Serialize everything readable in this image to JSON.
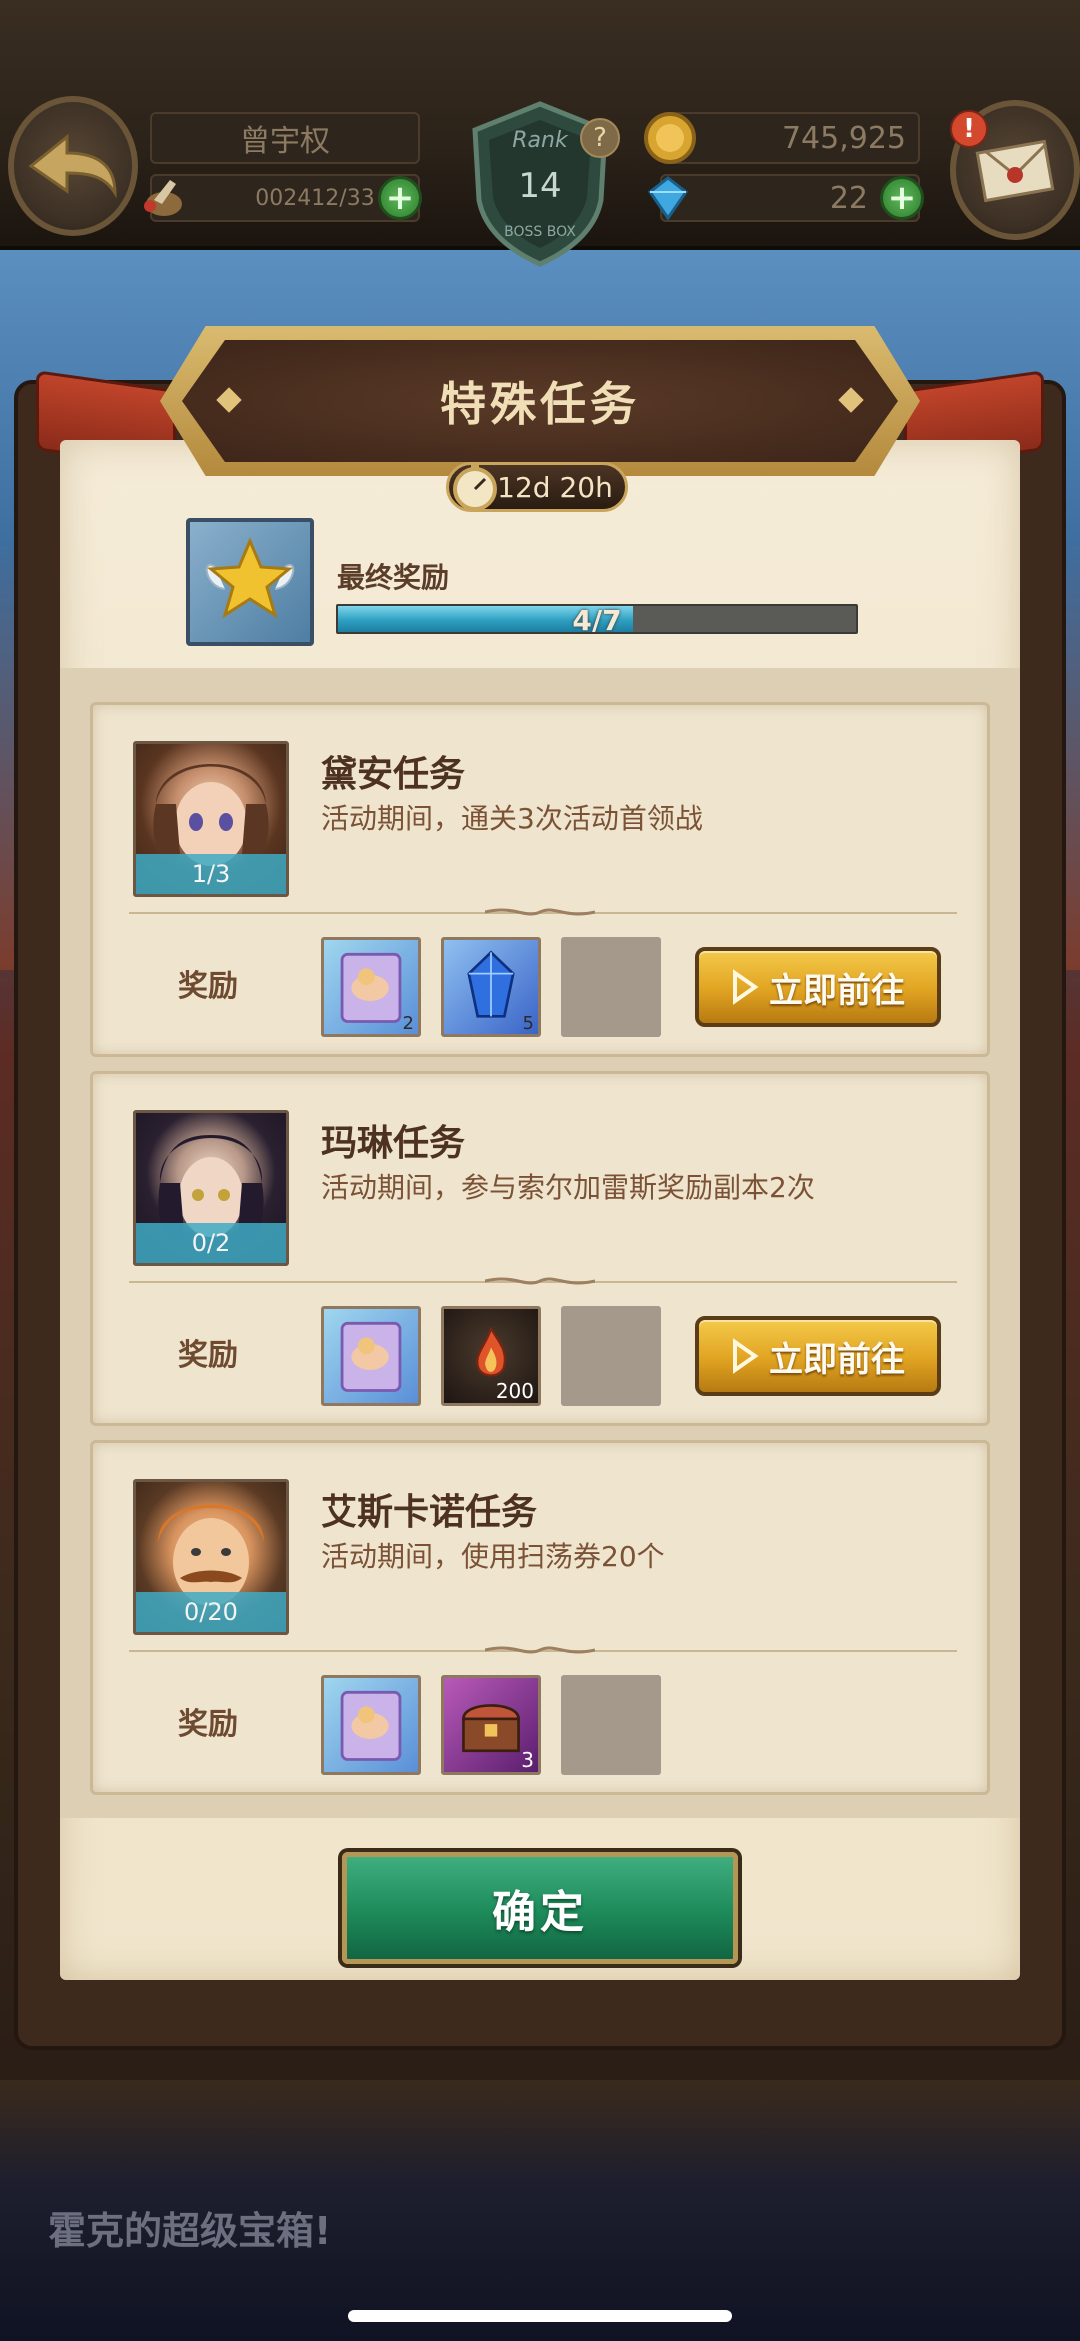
{
  "hud": {
    "player_name": "曾宇权",
    "stamina": "002412/33",
    "rank_label": "Rank",
    "rank_value": "14",
    "rank_sub": "BOSS BOX",
    "gold": "745,925",
    "gems": "22"
  },
  "dialog": {
    "title": "特殊任务",
    "timer": "12d 20h",
    "final_reward_label": "最终奖励",
    "final_progress_text": "4/7",
    "final_progress": 0.57,
    "confirm_label": "确定"
  },
  "quests": [
    {
      "title": "黛安任务",
      "description": "活动期间，通关3次活动首领战",
      "progress": "1/3",
      "reward_label": "奖励",
      "go_label": "立即前往",
      "rewards": [
        {
          "icon": "card-pack-icon",
          "count": "2"
        },
        {
          "icon": "blue-crystal-icon",
          "count": "5"
        }
      ]
    },
    {
      "title": "玛琳任务",
      "description": "活动期间，参与索尔加雷斯奖励副本2次",
      "progress": "0/2",
      "reward_label": "奖励",
      "go_label": "立即前往",
      "rewards": [
        {
          "icon": "card-pack-icon",
          "count": ""
        },
        {
          "icon": "fire-stone-icon",
          "count": "200"
        }
      ]
    },
    {
      "title": "艾斯卡诺任务",
      "description": "活动期间，使用扫荡券20个",
      "progress": "0/20",
      "reward_label": "奖励",
      "rewards": [
        {
          "icon": "card-pack-icon",
          "count": ""
        },
        {
          "icon": "treasure-chest-icon",
          "count": "3"
        }
      ]
    }
  ],
  "background_banner": "霍克的超级宝箱!"
}
